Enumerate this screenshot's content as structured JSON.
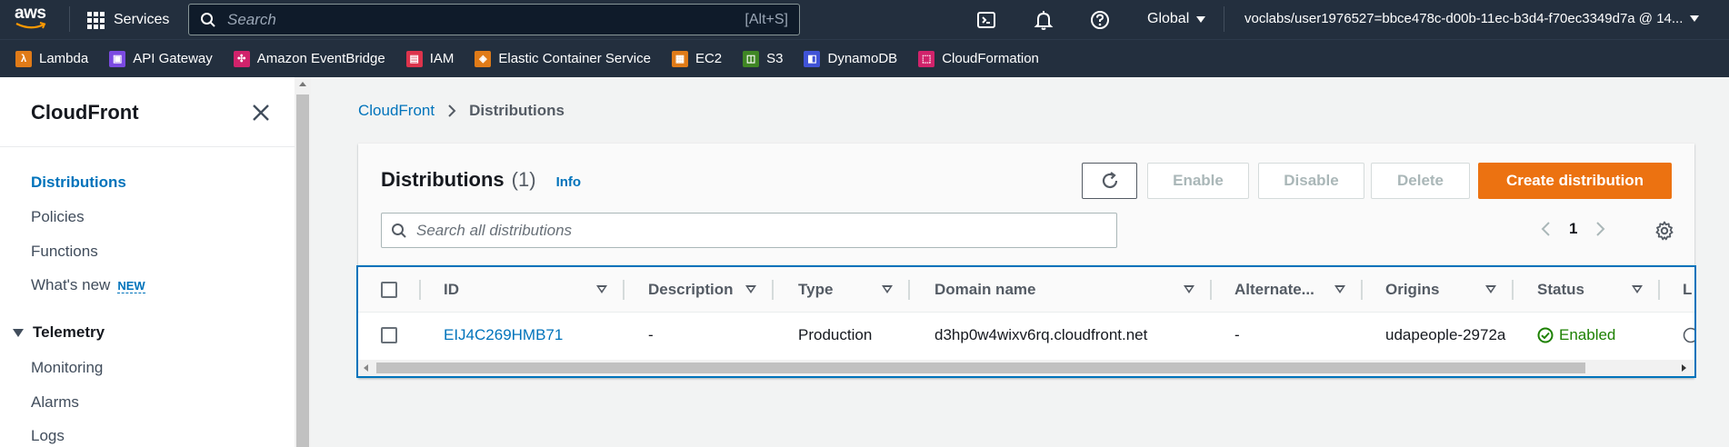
{
  "topnav": {
    "logo": "aws",
    "services_label": "Services",
    "search_placeholder": "Search",
    "search_shortcut": "[Alt+S]",
    "region": "Global",
    "account": "voclabs/user1976527=bbce478c-d00b-11ec-b3d4-f70ec3349d7a @ 14..."
  },
  "favorites": [
    {
      "label": "Lambda",
      "color": "#e07b18",
      "glyph": "λ"
    },
    {
      "label": "API Gateway",
      "color": "#7b4ae2",
      "glyph": "▣"
    },
    {
      "label": "Amazon EventBridge",
      "color": "#d1236b",
      "glyph": "✣"
    },
    {
      "label": "IAM",
      "color": "#dd344c",
      "glyph": "▤"
    },
    {
      "label": "Elastic Container Service",
      "color": "#e07b18",
      "glyph": "◈"
    },
    {
      "label": "EC2",
      "color": "#e07b18",
      "glyph": "▦"
    },
    {
      "label": "S3",
      "color": "#3f8624",
      "glyph": "◫"
    },
    {
      "label": "DynamoDB",
      "color": "#4053d6",
      "glyph": "◧"
    },
    {
      "label": "CloudFormation",
      "color": "#d1236b",
      "glyph": "⬚"
    }
  ],
  "sidebar": {
    "title": "CloudFront",
    "items": [
      {
        "label": "Distributions",
        "active": true
      },
      {
        "label": "Policies"
      },
      {
        "label": "Functions"
      },
      {
        "label": "What's new",
        "badge": "NEW"
      }
    ],
    "section": "Telemetry",
    "section_items": [
      {
        "label": "Monitoring"
      },
      {
        "label": "Alarms"
      },
      {
        "label": "Logs"
      }
    ]
  },
  "breadcrumb": {
    "root": "CloudFront",
    "current": "Distributions"
  },
  "panel": {
    "title": "Distributions",
    "count": "(1)",
    "info": "Info",
    "buttons": {
      "enable": "Enable",
      "disable": "Disable",
      "delete": "Delete",
      "create": "Create distribution"
    },
    "search_placeholder": "Search all distributions",
    "page": "1"
  },
  "table": {
    "columns": [
      "ID",
      "Description",
      "Type",
      "Domain name",
      "Alternate...",
      "Origins",
      "Status",
      "L"
    ],
    "rows": [
      {
        "id": "EIJ4C269HMB71",
        "description": "-",
        "type": "Production",
        "domain": "d3hp0w4wixv6rq.cloudfront.net",
        "alternate": "-",
        "origins": "udapeople-2972a",
        "status": "Enabled"
      }
    ]
  },
  "colors": {
    "nav_bg": "#232f3e",
    "link": "#0073bb",
    "primary": "#ec7211",
    "success": "#1d8102"
  }
}
